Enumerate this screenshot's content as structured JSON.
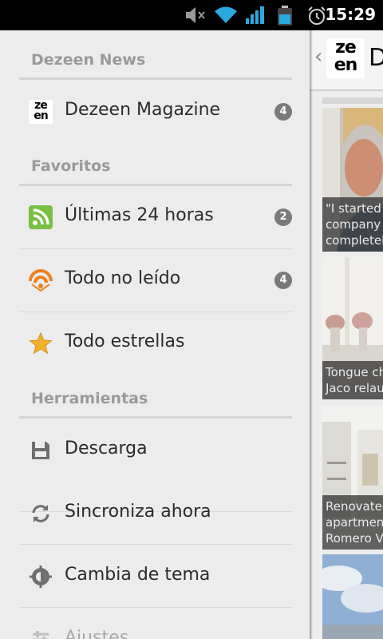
{
  "status_bar": {
    "time": "15:29",
    "icons": [
      "mute-icon",
      "wifi-icon",
      "signal-icon",
      "battery-icon",
      "alarm-icon"
    ]
  },
  "drawer": {
    "sections": [
      {
        "header": "Dezeen News",
        "items": [
          {
            "label": "Dezeen Magazine",
            "icon": "zeen-logo-icon",
            "badge": "4"
          }
        ]
      },
      {
        "header": "Favoritos",
        "items": [
          {
            "label": "Últimas 24 horas",
            "icon": "rss-icon",
            "badge": "2"
          },
          {
            "label": "Todo no leído",
            "icon": "unread-feed-icon",
            "badge": "4"
          },
          {
            "label": "Todo estrellas",
            "icon": "star-icon"
          }
        ]
      },
      {
        "header": "Herramientas",
        "items": [
          {
            "label": "Descarga",
            "icon": "save-icon"
          },
          {
            "label": "Sincroniza ahora",
            "icon": "sync-icon"
          },
          {
            "label": "Cambia de tema",
            "icon": "theme-icon"
          },
          {
            "label": "Ajustes",
            "icon": "settings-icon"
          }
        ]
      }
    ]
  },
  "content_pane": {
    "logo_text_top": "ze",
    "logo_text_bottom": "en",
    "title": "D",
    "articles": [
      {
        "caption": "\"I started company completel"
      },
      {
        "caption": "Tongue ch Arne Jaco relaunche"
      },
      {
        "caption": "Renovated apartment Romero V"
      },
      {
        "caption": ""
      }
    ]
  },
  "colors": {
    "drawer_bg": "#ececec",
    "badge_bg": "#7a7a7a",
    "section_header": "#9a9a9a",
    "rss_green": "#78c043",
    "feed_orange": "#f07f1f",
    "star_gold": "#f4b12e"
  }
}
